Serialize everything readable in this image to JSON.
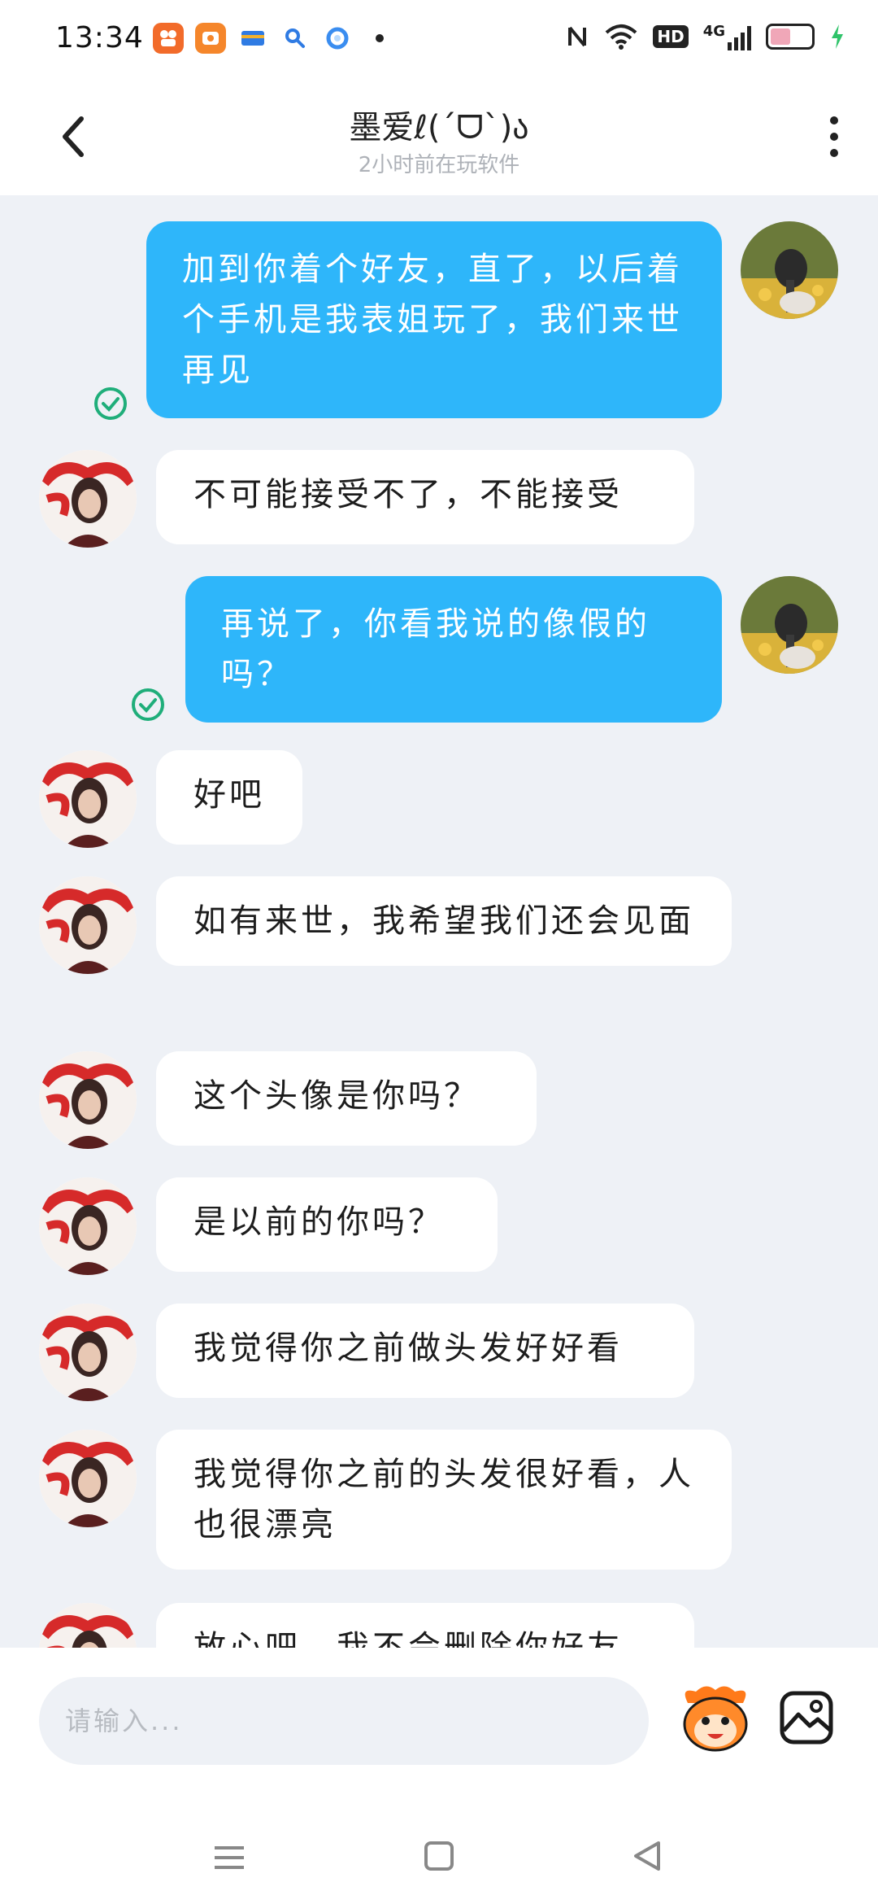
{
  "status_bar": {
    "time": "13:34",
    "notification_icons": [
      "kuaishou-icon",
      "taobao-icon",
      "wallet-icon",
      "search-app-icon",
      "browser-icon"
    ],
    "system_icons": [
      "nfc-icon",
      "wifi-icon",
      "hd-icon",
      "signal-4g-icon",
      "battery-icon",
      "charging-icon"
    ],
    "network_label": "4G",
    "hd_label": "HD"
  },
  "header": {
    "title": "墨爱ℓ(ˊᗜˋ)ა",
    "subtitle": "2小时前在玩软件"
  },
  "messages": [
    {
      "from": "self",
      "text": "加到你着个好友，直了，以后着个手机是我表姐玩了，我们来世再见",
      "read": true
    },
    {
      "from": "peer",
      "text": "不可能接受不了，不能接受"
    },
    {
      "from": "self",
      "text": "再说了，你看我说的像假的吗？",
      "read": true
    },
    {
      "from": "peer",
      "text": "好吧"
    },
    {
      "from": "peer",
      "text": "如有来世，我希望我们还会见面"
    },
    {
      "from": "peer",
      "text": "这个头像是你吗？"
    },
    {
      "from": "peer",
      "text": "是以前的你吗？"
    },
    {
      "from": "peer",
      "text": "我觉得你之前做头发好好看"
    },
    {
      "from": "peer",
      "text": "我觉得你之前的头发很好看，人也很漂亮"
    },
    {
      "from": "peer",
      "text": "放心吧，我不会删除你好友"
    }
  ],
  "input": {
    "placeholder": "请输入..."
  },
  "colors": {
    "self_bubble": "#2eb6fa",
    "peer_bubble": "#ffffff",
    "chat_background": "#eef1f6",
    "read_mark": "#1fae7a"
  }
}
